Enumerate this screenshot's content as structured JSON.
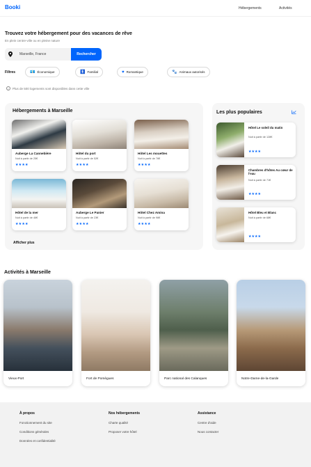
{
  "header": {
    "logo": "Booki",
    "nav": [
      "Hébergements",
      "Activités"
    ]
  },
  "hero": {
    "title": "Trouvez votre hébergement pour des vacances de rêve",
    "subtitle": "En plein centre-ville ou en pleine nature"
  },
  "search": {
    "value": "Marseille, France",
    "button": "Rechercher"
  },
  "filters": {
    "label": "Filtres",
    "items": [
      {
        "label": "Économique",
        "icon": "money-icon"
      },
      {
        "label": "Familial",
        "icon": "child-icon"
      },
      {
        "label": "Romantique",
        "icon": "heart-icon"
      },
      {
        "label": "Animaux autorisés",
        "icon": "paw-icon"
      }
    ]
  },
  "info": "Plus de 500 logements sont disponibles dans cette ville",
  "hotels": {
    "title": "Hébergements à Marseille",
    "more": "Afficher plus",
    "items": [
      {
        "name": "Auberge La Cannebière",
        "price": "Nuit à partir de 25€",
        "rating": 4,
        "stars": "★★★★"
      },
      {
        "name": "Hôtel du port",
        "price": "Nuit à partir de 52€",
        "rating": 4,
        "stars": "★★★★"
      },
      {
        "name": "Hôtel Les mouettes",
        "price": "Nuit à partir de 76€",
        "rating": 4,
        "stars": "★★★★"
      },
      {
        "name": "Hôtel de la mer",
        "price": "Nuit à partir de 46€",
        "rating": 4,
        "stars": "★★★★"
      },
      {
        "name": "Auberge Le Panier",
        "price": "Nuit à partir de 23€",
        "rating": 4,
        "stars": "★★★★"
      },
      {
        "name": "Hôtel Chez Amina",
        "price": "Nuit à partir de 96€",
        "rating": 4,
        "stars": "★★★★"
      }
    ]
  },
  "popular": {
    "title": "Les plus populaires",
    "icon": "trend-icon",
    "items": [
      {
        "name": "Hôtel Le soleil du matin",
        "price": "Nuit à partir de 128€",
        "rating": 4,
        "stars": "★★★★"
      },
      {
        "name": "Chambres d'hôtes Au cœur de l'eau",
        "price": "Nuit à partir de 71€",
        "rating": 4,
        "stars": "★★★★"
      },
      {
        "name": "Hôtel Bleu et Blanc",
        "price": "Nuit à partir de 68€",
        "rating": 4,
        "stars": "★★★★"
      }
    ]
  },
  "activities": {
    "title": "Activités à Marseille",
    "items": [
      {
        "name": "Vieux-Port"
      },
      {
        "name": "Fort de Pomègues"
      },
      {
        "name": "Parc national des Calanques"
      },
      {
        "name": "Notre-Dame-de-la-Garde"
      }
    ]
  },
  "footer": {
    "columns": [
      {
        "title": "À propos",
        "links": [
          "Fonctionnement du site",
          "Conditions générales",
          "Données et confidentialité"
        ]
      },
      {
        "title": "Nos hébergements",
        "links": [
          "Charte qualité",
          "Proposer votre hôtel"
        ]
      },
      {
        "title": "Assistance",
        "links": [
          "Centre d'aide",
          "Nous contacter"
        ]
      }
    ]
  },
  "colors": {
    "accent": "#0065fc",
    "panel": "#f6f6f6",
    "footer": "#f2f2f2"
  }
}
